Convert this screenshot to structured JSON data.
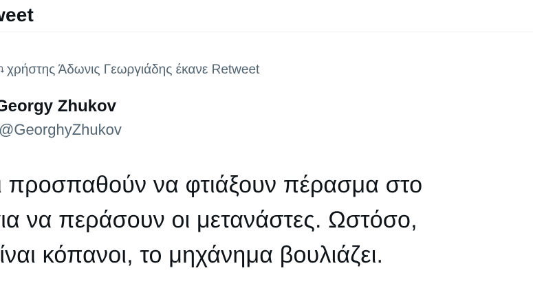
{
  "header": {
    "title": "weet"
  },
  "social_context": {
    "text": "χρήστης Άδωνις Γεωργιάδης έκανε Retweet",
    "icon": "retweet-icon"
  },
  "author": {
    "name": "Georgy Zhukov",
    "handle": "@GeorghyZhukov"
  },
  "tweet": {
    "lines": [
      "οι προσπαθούν να φτιάξουν πέρασμα στο",
      "για να περάσουν οι μετανάστες. Ωστόσο,",
      "είναι κόπανοι, το μηχάνημα βουλιάζει."
    ]
  }
}
